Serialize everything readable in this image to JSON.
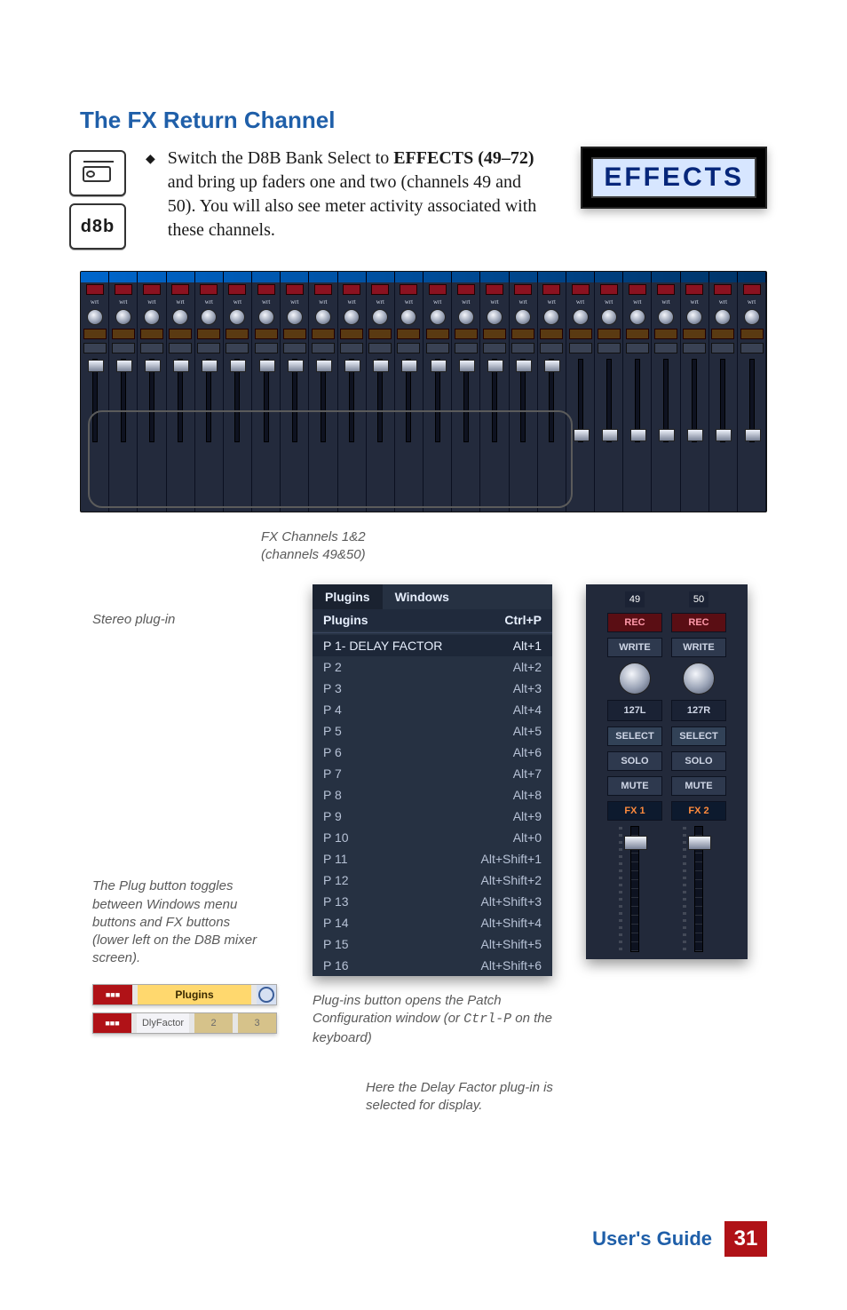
{
  "heading": "The FX Return Channel",
  "body_paragraph_pre": "Switch the D8B Bank Select to ",
  "body_paragraph_bold": "EFFECTS (49–72)",
  "body_paragraph_post": " and bring up faders one and two (channels 49 and 50). You will also see meter activity associated with these channels.",
  "icons": {
    "d8b_label": "d8b"
  },
  "effects_badge_label": "EFFECTS",
  "mixer": {
    "channel_count": 24
  },
  "captions": {
    "fx_channels_line1": "FX Channels 1&2",
    "fx_channels_line2": "(channels 49&50)",
    "stereo_plugin": "Stereo plug-in",
    "plug_button_desc": "The Plug button toggles between Windows menu buttons and FX buttons (lower left on the D8B mixer screen).",
    "plugins_button_desc_l1": "Plug-ins button opens the Patch",
    "plugins_button_desc_l2": "Configuration window (or ",
    "plugins_button_desc_code": "Ctrl-P",
    "plugins_button_desc_l3": " on the keyboard)",
    "delay_selected_l1": "Here the Delay Factor plug-in is",
    "delay_selected_l2": "selected for display."
  },
  "menu": {
    "tabs": {
      "plugins": "Plugins",
      "windows": "Windows"
    },
    "plugins_row": {
      "label": "Plugins",
      "shortcut": "Ctrl+P"
    },
    "items": [
      {
        "label": "P  1- DELAY FACTOR",
        "shortcut": "Alt+1",
        "selected": true
      },
      {
        "label": "P  2",
        "shortcut": "Alt+2"
      },
      {
        "label": "P  3",
        "shortcut": "Alt+3"
      },
      {
        "label": "P  4",
        "shortcut": "Alt+4"
      },
      {
        "label": "P  5",
        "shortcut": "Alt+5"
      },
      {
        "label": "P  6",
        "shortcut": "Alt+6"
      },
      {
        "label": "P  7",
        "shortcut": "Alt+7"
      },
      {
        "label": "P  8",
        "shortcut": "Alt+8"
      },
      {
        "label": "P  9",
        "shortcut": "Alt+9"
      },
      {
        "label": "P 10",
        "shortcut": "Alt+0"
      },
      {
        "label": "P 11",
        "shortcut": "Alt+Shift+1"
      },
      {
        "label": "P 12",
        "shortcut": "Alt+Shift+2"
      },
      {
        "label": "P 13",
        "shortcut": "Alt+Shift+3"
      },
      {
        "label": "P 14",
        "shortcut": "Alt+Shift+4"
      },
      {
        "label": "P 15",
        "shortcut": "Alt+Shift+5"
      },
      {
        "label": "P 16",
        "shortcut": "Alt+Shift+6"
      }
    ]
  },
  "strip_pair": {
    "numbers": [
      "49",
      "50"
    ],
    "rec": "REC",
    "write": "WRITE",
    "pan": [
      "127L",
      "127R"
    ],
    "select": "SELECT",
    "solo": "SOLO",
    "mute": "MUTE",
    "fx": [
      "FX 1",
      "FX 2"
    ]
  },
  "plug_strips": {
    "plugins_label": "Plugins",
    "dlyfactor_label": "DlyFactor",
    "slot2": "2",
    "slot3": "3"
  },
  "footer": {
    "users_guide": "User's Guide",
    "page_number": "31"
  }
}
